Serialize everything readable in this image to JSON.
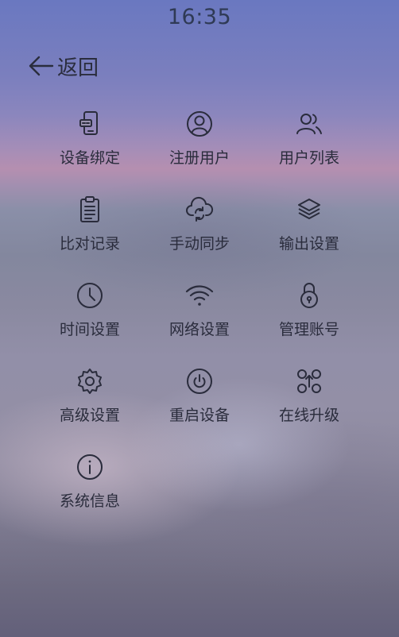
{
  "status_bar": {
    "time": "16:35"
  },
  "header": {
    "back_label": "返回"
  },
  "menu": {
    "items": [
      {
        "label": "设备绑定",
        "icon": "device-bind-icon"
      },
      {
        "label": "注册用户",
        "icon": "user-icon"
      },
      {
        "label": "用户列表",
        "icon": "users-icon"
      },
      {
        "label": "比对记录",
        "icon": "clipboard-icon"
      },
      {
        "label": "手动同步",
        "icon": "cloud-sync-icon"
      },
      {
        "label": "输出设置",
        "icon": "layers-icon"
      },
      {
        "label": "时间设置",
        "icon": "clock-icon"
      },
      {
        "label": "网络设置",
        "icon": "wifi-icon"
      },
      {
        "label": "管理账号",
        "icon": "lock-icon"
      },
      {
        "label": "高级设置",
        "icon": "gear-icon"
      },
      {
        "label": "重启设备",
        "icon": "power-icon"
      },
      {
        "label": "在线升级",
        "icon": "upgrade-icon"
      },
      {
        "label": "系统信息",
        "icon": "info-icon"
      }
    ]
  }
}
